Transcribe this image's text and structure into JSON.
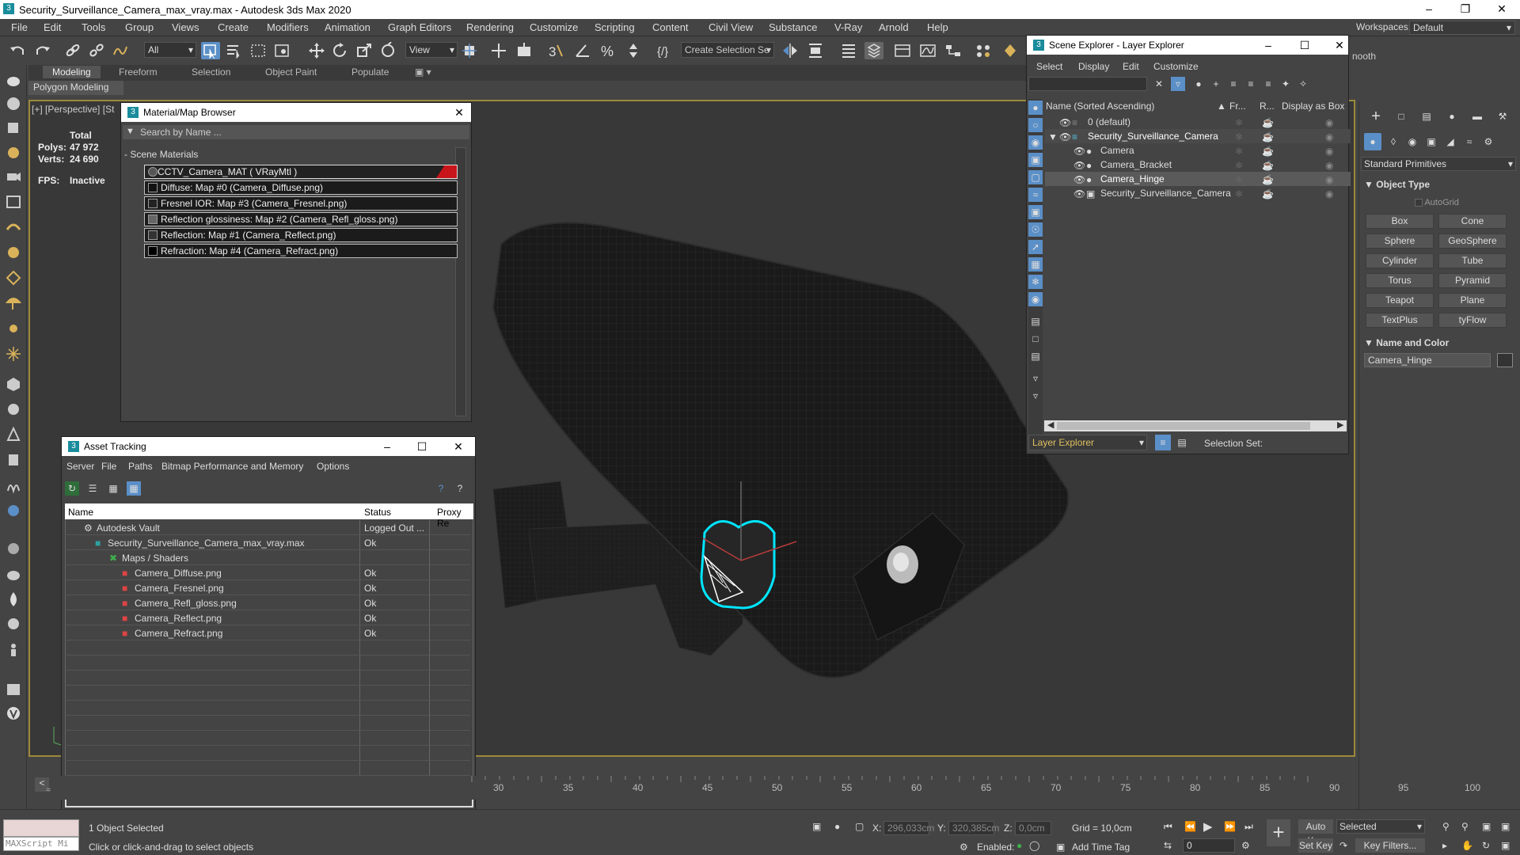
{
  "window": {
    "title": "Security_Surveillance_Camera_max_vray.max - Autodesk 3ds Max 2020",
    "app_icon": "3"
  },
  "menu": [
    "File",
    "Edit",
    "Tools",
    "Group",
    "Views",
    "Create",
    "Modifiers",
    "Animation",
    "Graph Editors",
    "Rendering",
    "Customize",
    "Scripting",
    "Content",
    "Civil View",
    "Substance",
    "V-Ray",
    "Arnold",
    "Help"
  ],
  "workspaces": {
    "label": "Workspaces:",
    "value": "Default"
  },
  "toolbar": {
    "filter_value": "All",
    "ref_coord": "View",
    "selection_set_placeholder": "Create Selection Se"
  },
  "ribbon": {
    "tabs": [
      "Modeling",
      "Freeform",
      "Selection",
      "Object Paint",
      "Populate"
    ],
    "active": "Modeling",
    "sub": "Polygon Modeling"
  },
  "viewport": {
    "label_parts": [
      "[+]",
      "[Perspective]",
      "[St"
    ],
    "stats": {
      "total_label": "Total",
      "polys_label": "Polys:",
      "polys": "47 972",
      "verts_label": "Verts:",
      "verts": "24 690",
      "fps_label": "FPS:",
      "fps": "Inactive"
    }
  },
  "material_browser": {
    "title": "Material/Map Browser",
    "search_placeholder": "Search by Name ...",
    "section": "- Scene Materials",
    "material": "CCTV_Camera_MAT  ( VRayMtl )",
    "maps": [
      "Diffuse: Map #0 (Camera_Diffuse.png)",
      "Fresnel IOR: Map #3 (Camera_Fresnel.png)",
      "Reflection glossiness: Map #2 (Camera_Refl_gloss.png)",
      "Reflection: Map #1 (Camera_Reflect.png)",
      "Refraction: Map #4 (Camera_Refract.png)"
    ]
  },
  "asset_tracking": {
    "title": "Asset Tracking",
    "menu": [
      "Server",
      "File",
      "Paths",
      "Bitmap Performance and Memory",
      "Options"
    ],
    "columns": [
      "Name",
      "Status",
      "Proxy Re"
    ],
    "rows": [
      {
        "name": "Autodesk Vault",
        "status": "Logged Out ..."
      },
      {
        "name": "Security_Surveillance_Camera_max_vray.max",
        "status": "Ok"
      },
      {
        "name": "Maps / Shaders",
        "status": ""
      },
      {
        "name": "Camera_Diffuse.png",
        "status": "Ok"
      },
      {
        "name": "Camera_Fresnel.png",
        "status": "Ok"
      },
      {
        "name": "Camera_Refl_gloss.png",
        "status": "Ok"
      },
      {
        "name": "Camera_Reflect.png",
        "status": "Ok"
      },
      {
        "name": "Camera_Refract.png",
        "status": "Ok"
      }
    ]
  },
  "scene_explorer": {
    "title": "Scene Explorer - Layer Explorer",
    "menu": [
      "Select",
      "Display",
      "Edit",
      "Customize"
    ],
    "columns": [
      "Name (Sorted Ascending)",
      "Fr...",
      "R...",
      "Display as Box"
    ],
    "rows": [
      {
        "name": "0 (default)"
      },
      {
        "name": "Security_Surveillance_Camera"
      },
      {
        "name": "Camera"
      },
      {
        "name": "Camera_Bracket"
      },
      {
        "name": "Camera_Hinge"
      },
      {
        "name": "Security_Surveillance_Camera"
      }
    ],
    "footer_explorer": "Layer Explorer",
    "selection_set_label": "Selection Set:"
  },
  "command_panel": {
    "dropdown": "Standard Primitives",
    "object_type_header": "Object Type",
    "autogrid": "AutoGrid",
    "buttons": [
      "Box",
      "Cone",
      "Sphere",
      "GeoSphere",
      "Cylinder",
      "Tube",
      "Torus",
      "Pyramid",
      "Teapot",
      "Plane",
      "TextPlus",
      "tyFlow"
    ],
    "name_color_header": "Name and Color",
    "object_name": "Camera_Hinge",
    "smooth_fragment": "nooth"
  },
  "timeline": {
    "ticks": [
      "30",
      "35",
      "40",
      "45",
      "50",
      "55",
      "60",
      "65",
      "70",
      "75",
      "80",
      "85",
      "90",
      "95",
      "100"
    ]
  },
  "status": {
    "maxscript": "MAXScript Mi",
    "selected": "1 Object Selected",
    "hint": "Click or click-and-drag to select objects",
    "x_label": "X:",
    "x": "296,033cm",
    "y_label": "Y:",
    "y": "320,385cm",
    "z_label": "Z:",
    "z": "0,0cm",
    "grid": "Grid = 10,0cm",
    "enabled": "Enabled:",
    "add_time_tag": "Add Time Tag",
    "auto_key": "Auto Key",
    "selected_dropdown": "Selected",
    "set_key": "Set Key",
    "key_filters": "Key Filters...",
    "frame": "0"
  },
  "colors": {
    "accent": "#1a8c9c",
    "viewport_border": "#9d8a3b",
    "selection": "#00e5ff"
  }
}
